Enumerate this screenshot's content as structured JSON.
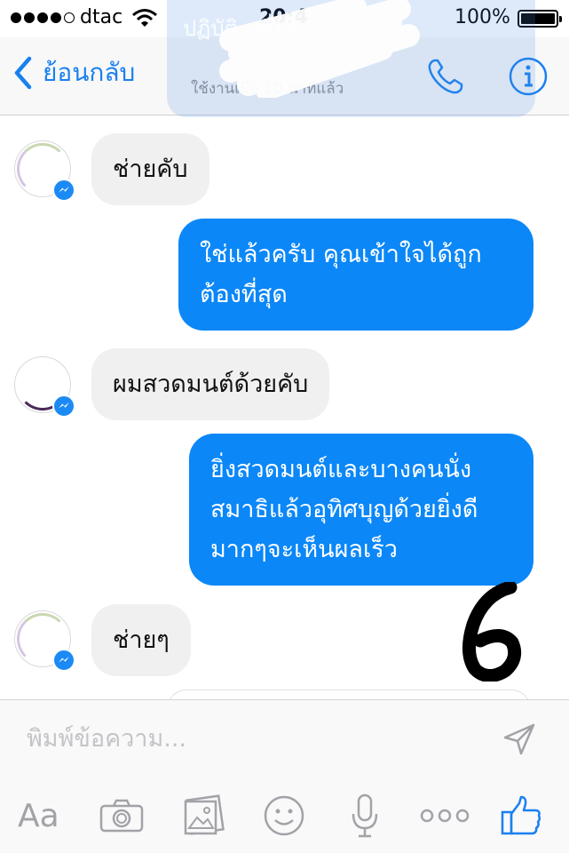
{
  "status": {
    "carrier": "dtac",
    "time": "20:4",
    "battery": "100%"
  },
  "nav": {
    "back_label": "ย้อนกลับ",
    "subtitle": "ใช้งานเมื่อ 10 นาทีแล้ว"
  },
  "banner": {
    "text": "ปฏิบัติ...ที่ได้"
  },
  "messages": [
    {
      "side": "incoming",
      "text": "ช่ายคับ"
    },
    {
      "side": "outgoing",
      "text": "ใช่แล้วครับ คุณเข้าใจได้ถูก ต้องที่สุด"
    },
    {
      "side": "incoming",
      "text": "ผมสวดมนต์ด้วยคับ"
    },
    {
      "side": "outgoing",
      "text": "ยิ่งสวดมนต์และบางคนนั่ง สมาธิแล้วอุทิศบุญด้วยยิ่งดี มากๆจะเห็นผลเร็ว"
    },
    {
      "side": "incoming",
      "text": "ช่ายๆ"
    }
  ],
  "annotation": "6",
  "composer": {
    "placeholder": "พิมพ์ข้อความ...",
    "aa_label": "Aa"
  },
  "colors": {
    "accent": "#1a80f0",
    "outgoing_bubble": "#0b87f7",
    "incoming_bubble": "#f1f0f0"
  },
  "icons": [
    "chevron-left-icon",
    "phone-icon",
    "info-icon",
    "send-icon",
    "camera-icon",
    "photo-icon",
    "emoji-icon",
    "microphone-icon",
    "more-icon",
    "like-icon",
    "messenger-badge-icon"
  ]
}
